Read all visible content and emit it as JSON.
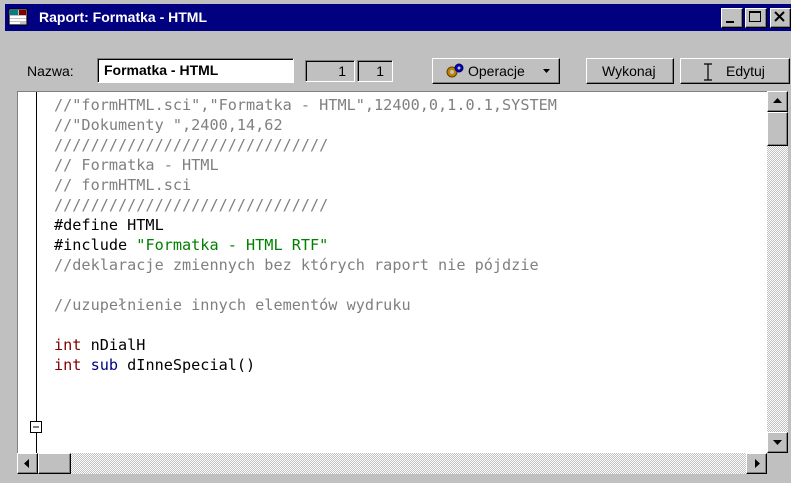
{
  "window": {
    "title": "Raport: Formatka - HTML",
    "controls": {
      "minimize": "minimize-icon",
      "maximize": "maximize-icon",
      "close": "close-icon"
    }
  },
  "toolbar": {
    "name_label": "Nazwa:",
    "name_value": "Formatka - HTML",
    "num1": "1",
    "num2": "1",
    "operacje_label": "Operacje",
    "wykonaj_label": "Wykonaj",
    "edytuj_label": "Edytuj"
  },
  "editor": {
    "lines": [
      {
        "text": "//\"formHTML.sci\",\"Formatka - HTML\",12400,0,1.0.1,SYSTEM",
        "kind": "comment"
      },
      {
        "text": "//\"Dokumenty \",2400,14,62",
        "kind": "comment"
      },
      {
        "text": "//////////////////////////////",
        "kind": "comment"
      },
      {
        "text": "// Formatka - HTML",
        "kind": "comment"
      },
      {
        "text": "// formHTML.sci",
        "kind": "comment"
      },
      {
        "text": "//////////////////////////////",
        "kind": "comment"
      },
      {
        "text": "#define HTML",
        "kind": "plain"
      },
      {
        "pre": "#include ",
        "str": "\"Formatka - HTML RTF\"",
        "kind": "include"
      },
      {
        "text": "//deklaracje zmiennych bez których raport nie pójdzie",
        "kind": "comment"
      },
      {
        "text": "",
        "kind": "plain"
      },
      {
        "text": "//uzupełnienie innych elementów wydruku",
        "kind": "comment"
      },
      {
        "text": "",
        "kind": "plain"
      },
      {
        "kw": "int",
        "rest": " nDialH",
        "kind": "decl"
      },
      {
        "kw": "int",
        "kw2": " sub",
        "rest": " dInneSpecial()",
        "kind": "decl2"
      }
    ]
  },
  "colors": {
    "titlebar": "#000080",
    "comment": "#808080",
    "keyword": "#000080",
    "string": "#008000",
    "type": "#800000"
  }
}
